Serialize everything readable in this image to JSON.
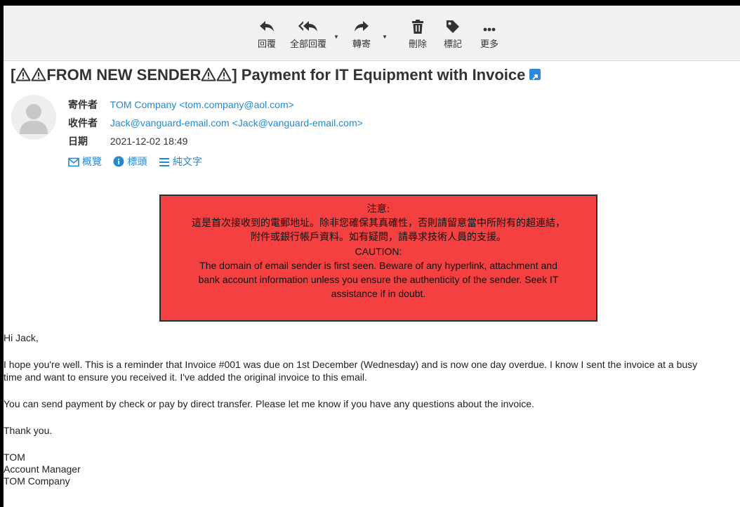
{
  "toolbar": {
    "reply_label": "回覆",
    "reply_all_label": "全部回覆",
    "forward_label": "轉寄",
    "delete_label": "刪除",
    "mark_label": "標記",
    "more_label": "更多"
  },
  "email": {
    "subject_prefix": "[",
    "subject_from_new_sender": "FROM NEW SENDER",
    "subject_rest": "] Payment for IT Equipment with Invoice",
    "from_key": "寄件者",
    "from_value": "TOM Company <tom.company@aol.com>",
    "to_key": "收件者",
    "to_value": "Jack@vanguard-email.com <Jack@vanguard-email.com>",
    "date_key": "日期",
    "date_value": "2021-12-02 18:49",
    "view_summary": "概覽",
    "view_headers": "標頭",
    "view_plaintext": "純文字"
  },
  "caution": {
    "zh_title": "注意:",
    "zh_line1": "這是首次接收到的電郵地址。除非您確保其真確性，否則請留意當中所附有的超連結，",
    "zh_line2": "附件或銀行帳戶資料。如有疑問，請尋求技術人員的支援。",
    "en_title": "CAUTION:",
    "en_line1": "The domain of email sender is first seen.  Beware of any hyperlink, attachment and",
    "en_line2": "bank account information unless you ensure the authenticity of the sender.  Seek IT",
    "en_line3": "assistance if in doubt."
  },
  "body": {
    "greeting": "Hi Jack,",
    "para1_line1": "I hope you're well.  This is a reminder that Invoice #001 was due on 1st December (Wednesday) and is now one day overdue. I know I sent the invoice at a busy",
    "para1_line2": "time and want to ensure you received it. I've added the original invoice to this email.",
    "para2": "You can send payment by check or pay by direct transfer. Please let me know if you have any questions about the invoice.",
    "thanks": "Thank you.",
    "sig_name": "TOM",
    "sig_title": "Account Manager",
    "sig_company": "TOM Company"
  },
  "colors": {
    "link": "#1f8ad6",
    "caution_bg": "#f44040",
    "toolbar_bg": "#f1f1f1"
  }
}
